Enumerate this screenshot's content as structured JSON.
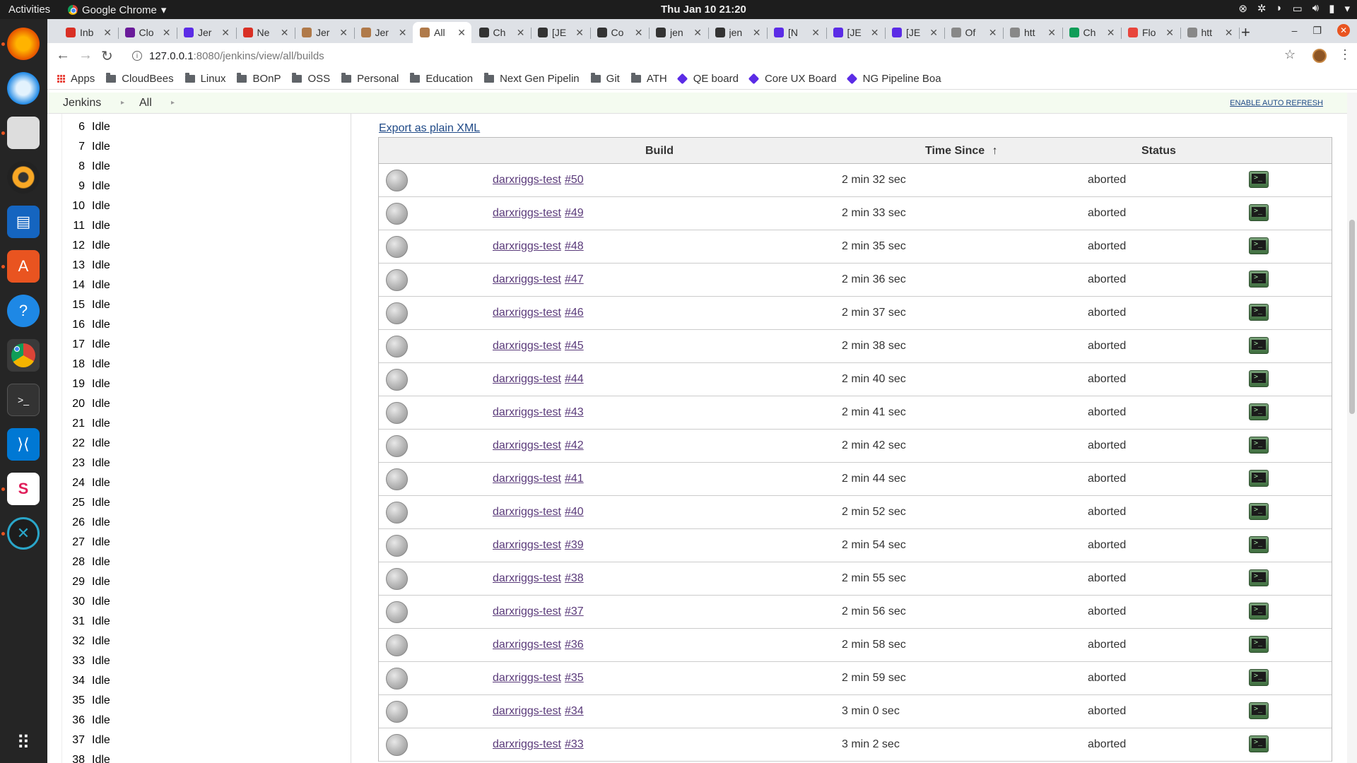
{
  "topbar": {
    "activities": "Activities",
    "app_name": "Google Chrome",
    "clock": "Thu Jan 10  21:20"
  },
  "dock": {
    "items": [
      "firefox-icon",
      "thunderbird-icon",
      "files-icon",
      "rhythmbox-icon",
      "writer-icon",
      "software-icon",
      "help-icon",
      "chrome-icon",
      "terminal-icon",
      "vscode-icon",
      "slack-icon",
      "crossover-icon",
      "show-apps-icon"
    ]
  },
  "tabs": [
    {
      "title": "Inb",
      "color": "#d93025"
    },
    {
      "title": "Clo",
      "color": "#6a1b9a"
    },
    {
      "title": "Jer",
      "color": "#5b2ce6"
    },
    {
      "title": "Ne",
      "color": "#d93025"
    },
    {
      "title": "Jer",
      "color": "#b07a4a"
    },
    {
      "title": "Jer",
      "color": "#b07a4a"
    },
    {
      "title": "All",
      "color": "#b07a4a",
      "active": true
    },
    {
      "title": "Ch",
      "color": "#333333"
    },
    {
      "title": "[JE",
      "color": "#333333"
    },
    {
      "title": "Co",
      "color": "#333333"
    },
    {
      "title": "jen",
      "color": "#333333"
    },
    {
      "title": "jen",
      "color": "#333333"
    },
    {
      "title": "[N",
      "color": "#5b2ce6"
    },
    {
      "title": "[JE",
      "color": "#5b2ce6"
    },
    {
      "title": "[JE",
      "color": "#5b2ce6"
    },
    {
      "title": "Of",
      "color": "#888888"
    },
    {
      "title": "htt",
      "color": "#888888"
    },
    {
      "title": "Ch",
      "color": "#0f9d58"
    },
    {
      "title": "Flo",
      "color": "#e8453c"
    },
    {
      "title": "htt",
      "color": "#888888"
    }
  ],
  "url": {
    "host": "127.0.0.1",
    "path": ":8080/jenkins/view/all/builds"
  },
  "bookmarks": [
    {
      "label": "Apps",
      "kind": "apps"
    },
    {
      "label": "CloudBees",
      "kind": "folder"
    },
    {
      "label": "Linux",
      "kind": "folder"
    },
    {
      "label": "BOnP",
      "kind": "folder"
    },
    {
      "label": "OSS",
      "kind": "folder"
    },
    {
      "label": "Personal",
      "kind": "folder"
    },
    {
      "label": "Education",
      "kind": "folder"
    },
    {
      "label": "Next Gen Pipelin",
      "kind": "folder"
    },
    {
      "label": "Git",
      "kind": "folder"
    },
    {
      "label": "ATH",
      "kind": "folder"
    },
    {
      "label": "QE board",
      "kind": "diamond"
    },
    {
      "label": "Core UX Board",
      "kind": "diamond"
    },
    {
      "label": "NG Pipeline Boa",
      "kind": "diamond"
    }
  ],
  "breadcrumbs": {
    "root": "Jenkins",
    "view": "All",
    "auto_refresh": "ENABLE AUTO REFRESH"
  },
  "executors": [
    {
      "num": "6",
      "state": "Idle"
    },
    {
      "num": "7",
      "state": "Idle"
    },
    {
      "num": "8",
      "state": "Idle"
    },
    {
      "num": "9",
      "state": "Idle"
    },
    {
      "num": "10",
      "state": "Idle"
    },
    {
      "num": "11",
      "state": "Idle"
    },
    {
      "num": "12",
      "state": "Idle"
    },
    {
      "num": "13",
      "state": "Idle"
    },
    {
      "num": "14",
      "state": "Idle"
    },
    {
      "num": "15",
      "state": "Idle"
    },
    {
      "num": "16",
      "state": "Idle"
    },
    {
      "num": "17",
      "state": "Idle"
    },
    {
      "num": "18",
      "state": "Idle"
    },
    {
      "num": "19",
      "state": "Idle"
    },
    {
      "num": "20",
      "state": "Idle"
    },
    {
      "num": "21",
      "state": "Idle"
    },
    {
      "num": "22",
      "state": "Idle"
    },
    {
      "num": "23",
      "state": "Idle"
    },
    {
      "num": "24",
      "state": "Idle"
    },
    {
      "num": "25",
      "state": "Idle"
    },
    {
      "num": "26",
      "state": "Idle"
    },
    {
      "num": "27",
      "state": "Idle"
    },
    {
      "num": "28",
      "state": "Idle"
    },
    {
      "num": "29",
      "state": "Idle"
    },
    {
      "num": "30",
      "state": "Idle"
    },
    {
      "num": "31",
      "state": "Idle"
    },
    {
      "num": "32",
      "state": "Idle"
    },
    {
      "num": "33",
      "state": "Idle"
    },
    {
      "num": "34",
      "state": "Idle"
    },
    {
      "num": "35",
      "state": "Idle"
    },
    {
      "num": "36",
      "state": "Idle"
    },
    {
      "num": "37",
      "state": "Idle"
    },
    {
      "num": "38",
      "state": "Idle"
    }
  ],
  "builds": {
    "export_link": "Export as plain XML",
    "headers": {
      "build": "Build",
      "time": "Time Since",
      "sort_arrow": "↑",
      "status": "Status"
    },
    "rows": [
      {
        "job": "darxriggs-test",
        "number": "#50",
        "time": "2 min 32 sec",
        "status": "aborted"
      },
      {
        "job": "darxriggs-test",
        "number": "#49",
        "time": "2 min 33 sec",
        "status": "aborted"
      },
      {
        "job": "darxriggs-test",
        "number": "#48",
        "time": "2 min 35 sec",
        "status": "aborted"
      },
      {
        "job": "darxriggs-test",
        "number": "#47",
        "time": "2 min 36 sec",
        "status": "aborted"
      },
      {
        "job": "darxriggs-test",
        "number": "#46",
        "time": "2 min 37 sec",
        "status": "aborted"
      },
      {
        "job": "darxriggs-test",
        "number": "#45",
        "time": "2 min 38 sec",
        "status": "aborted"
      },
      {
        "job": "darxriggs-test",
        "number": "#44",
        "time": "2 min 40 sec",
        "status": "aborted"
      },
      {
        "job": "darxriggs-test",
        "number": "#43",
        "time": "2 min 41 sec",
        "status": "aborted"
      },
      {
        "job": "darxriggs-test",
        "number": "#42",
        "time": "2 min 42 sec",
        "status": "aborted"
      },
      {
        "job": "darxriggs-test",
        "number": "#41",
        "time": "2 min 44 sec",
        "status": "aborted"
      },
      {
        "job": "darxriggs-test",
        "number": "#40",
        "time": "2 min 52 sec",
        "status": "aborted"
      },
      {
        "job": "darxriggs-test",
        "number": "#39",
        "time": "2 min 54 sec",
        "status": "aborted"
      },
      {
        "job": "darxriggs-test",
        "number": "#38",
        "time": "2 min 55 sec",
        "status": "aborted"
      },
      {
        "job": "darxriggs-test",
        "number": "#37",
        "time": "2 min 56 sec",
        "status": "aborted"
      },
      {
        "job": "darxriggs-test",
        "number": "#36",
        "time": "2 min 58 sec",
        "status": "aborted"
      },
      {
        "job": "darxriggs-test",
        "number": "#35",
        "time": "2 min 59 sec",
        "status": "aborted"
      },
      {
        "job": "darxriggs-test",
        "number": "#34",
        "time": "3 min 0 sec",
        "status": "aborted"
      },
      {
        "job": "darxriggs-test",
        "number": "#33",
        "time": "3 min 2 sec",
        "status": "aborted"
      }
    ]
  }
}
